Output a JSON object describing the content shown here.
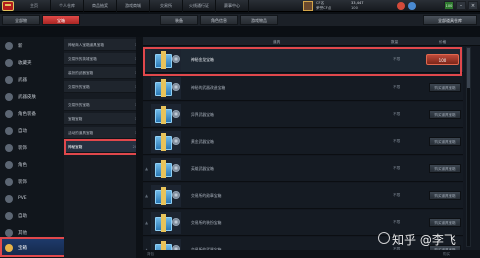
{
  "topbar": {
    "nav": [
      "主页",
      "个人仓库",
      "商品抽奖",
      "游戏商城",
      "交易所",
      "火线通行证",
      "赛事中心"
    ],
    "user": {
      "line1": "CF名",
      "line2": "荣誉CF点",
      "cf_points": "33,447",
      "level_points": "100"
    },
    "level_badge": "100",
    "win_buttons": [
      "–",
      "×"
    ]
  },
  "tabs": [
    "全部物",
    "宝箱",
    "装备",
    "角色信息",
    "游戏物品"
  ],
  "tab_right": "全部道具仓库",
  "sidebar": {
    "items": [
      {
        "label": "新",
        "icon": "new-icon"
      },
      {
        "label": "收藏夹",
        "icon": "star-icon"
      },
      {
        "label": "武器",
        "icon": "gun-icon"
      },
      {
        "label": "武器皮肤",
        "icon": "skin-icon"
      },
      {
        "label": "角色装备",
        "icon": "armor-icon"
      },
      {
        "label": "自动",
        "icon": "auto-icon"
      },
      {
        "label": "装饰",
        "icon": "decor-icon"
      },
      {
        "label": "角色",
        "icon": "character-icon"
      },
      {
        "label": "装饰",
        "icon": "ornament-icon"
      },
      {
        "label": "PVE",
        "icon": "pve-icon"
      },
      {
        "label": "自助",
        "icon": "self-icon"
      },
      {
        "label": "其他",
        "icon": "misc-icon"
      },
      {
        "label": "宝箱",
        "icon": "chest-icon"
      }
    ]
  },
  "subcategories": [
    {
      "label": "神秘商人宝箱道具宝箱",
      "count": "1"
    },
    {
      "label": "交易所的英雄宝箱",
      "count": "1"
    },
    {
      "label": "装扮的武器宝箱",
      "count": "1"
    },
    {
      "label": "交易所的宝箱",
      "count": "1"
    },
    {
      "label": "交易所的宝箱",
      "count": "1"
    },
    {
      "label": "宝箱宝箱",
      "count": "1"
    },
    {
      "label": "活动的道具宝箱",
      "count": "1"
    },
    {
      "label": "神秘宝箱",
      "count": "20"
    }
  ],
  "list_header": {
    "name": "道具",
    "qty": "数量",
    "price": "价格"
  },
  "rows": [
    {
      "name": "神秘金龙宝箱",
      "qty": "不限",
      "price": "100"
    },
    {
      "name": "神秘的武器改造宝箱",
      "qty": "不限",
      "button": "购买道具宝箱"
    },
    {
      "name": "异界武器宝箱",
      "qty": "不限",
      "button": "购买道具宝箱"
    },
    {
      "name": "黄金武器宝箱",
      "qty": "不限",
      "button": "购买道具宝箱"
    },
    {
      "name": "英雄武器宝箱",
      "qty": "不限",
      "button": "购买道具宝箱"
    },
    {
      "name": "交易所的勋章宝箱",
      "qty": "不限",
      "button": "购买道具宝箱"
    },
    {
      "name": "交易所的装扮宝箱",
      "qty": "不限",
      "button": "购买道具宝箱"
    },
    {
      "name": "交易所的武器宝箱",
      "qty": "不限",
      "button": "购买道具宝箱"
    }
  ],
  "bottom": {
    "left": "背包",
    "right": "购买"
  },
  "watermark": "知乎 @李飞",
  "colors": {
    "accent": "#e0484c",
    "active_tab": "#c7302e",
    "sidebar_active": "#1e3a6a"
  }
}
